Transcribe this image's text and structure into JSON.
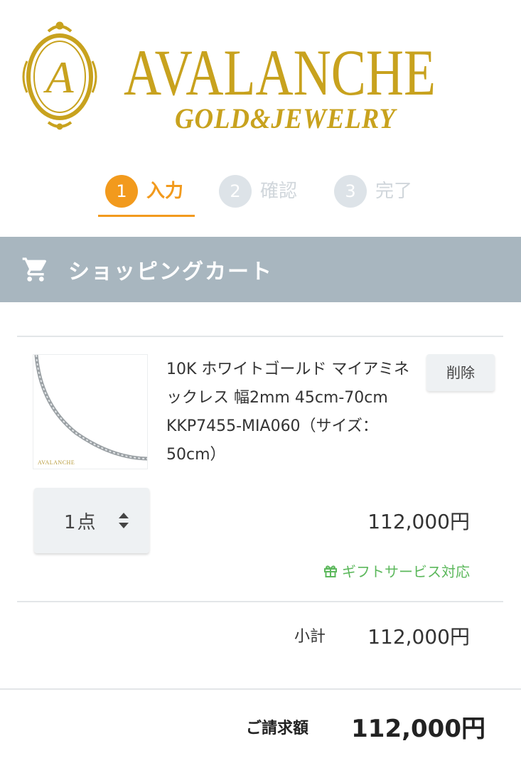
{
  "brand": {
    "name": "AVALANCHE",
    "subtitle": "GOLD&JEWELRY",
    "monogram": "A",
    "color": "#c8a21e"
  },
  "steps": [
    {
      "number": "1",
      "label": "入力",
      "state": "active"
    },
    {
      "number": "2",
      "label": "確認",
      "state": "inactive"
    },
    {
      "number": "3",
      "label": "完了",
      "state": "inactive"
    }
  ],
  "cart": {
    "title": "ショッピングカート",
    "icon": "cart-icon",
    "header_color": "#a8b6bf"
  },
  "item": {
    "image_brand": "AVALANCHE",
    "name": "10K ホワイトゴールド マイアミネックレス 幅2mm 45cm-70cm　KKP7455-MIA060（サイズ：50cm）",
    "delete_label": "削除",
    "quantity": "1点",
    "price": "112,000円",
    "gift_service": "ギフトサービス対応",
    "gift_icon": "gift-icon",
    "gift_color": "#5cb85c"
  },
  "summary": {
    "subtotal_label": "小計",
    "subtotal_value": "112,000円",
    "total_label": "ご請求額",
    "total_value": "112,000円"
  },
  "colors": {
    "accent": "#f29a1d",
    "inactive_step": "#dde3e8"
  }
}
